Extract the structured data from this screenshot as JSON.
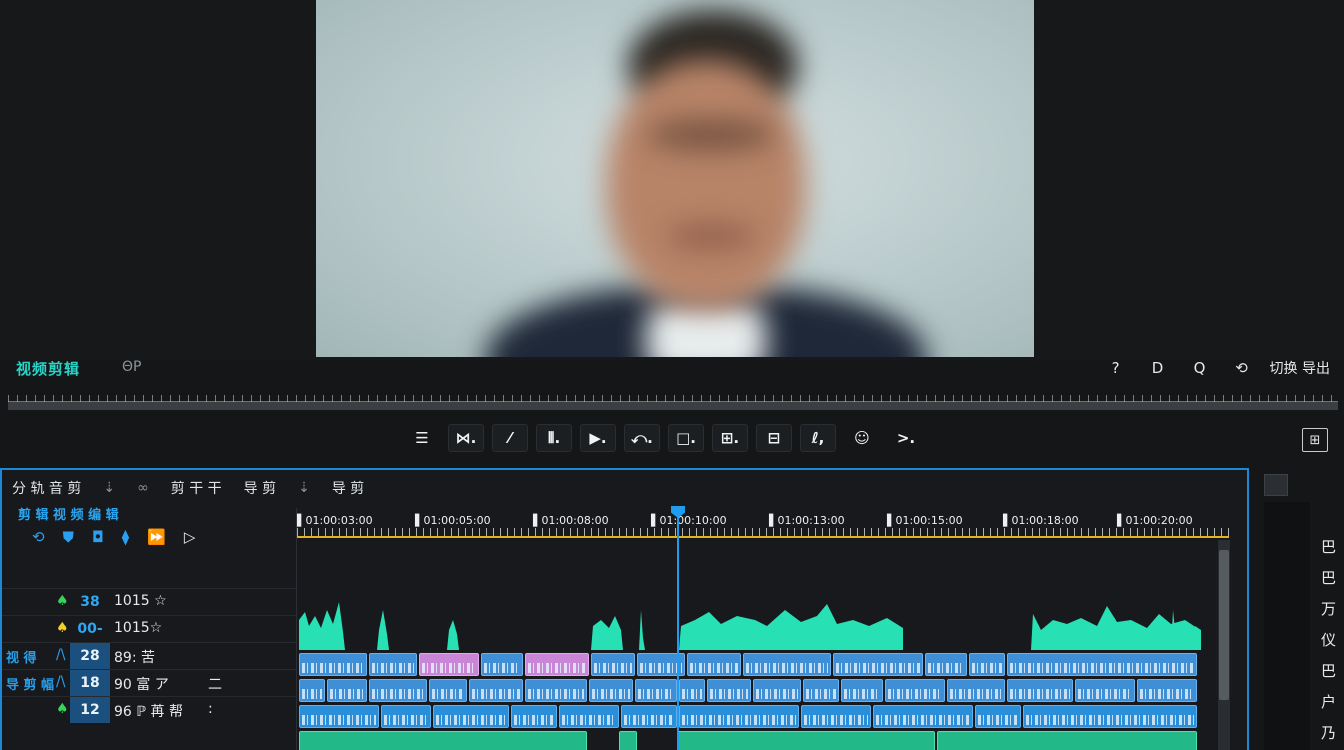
{
  "viewer": {
    "title": "视频剪辑",
    "subtitle": "ΘP",
    "tools": [
      "?",
      "D",
      "Q",
      "⟲"
    ],
    "tools_label": "切换 导出"
  },
  "transport": {
    "buttons": [
      "☰",
      "⋈.",
      "⁄",
      "⦀.",
      "▶.",
      "⤺.",
      "□.",
      "⊞.",
      "⊟",
      "ℓ,",
      "☺",
      ">."
    ],
    "fit_label": "⊞"
  },
  "timeline": {
    "toolbar": [
      "分 轨 音 剪",
      "⇣",
      "∞",
      "剪 干 干",
      "导 剪",
      "⇣",
      "导 剪"
    ],
    "title": "剪 辑 视 频 编 辑",
    "icons": [
      "⟲",
      "⛊",
      "◘",
      "⧫",
      "⏩",
      "▷"
    ],
    "ruler_labels": [
      "▌01:00:03:00",
      "▌01:00:05:00",
      "▌01:00:08:00",
      "▌01:00:10:00",
      "▌01:00:13:00",
      "▌01:00:15:00",
      "▌01:00:18:00",
      "▌01:00:20:00"
    ],
    "tracks": [
      {
        "lock": "♠",
        "num": "38",
        "name": "1015 ☆",
        "side": "",
        "extra": ""
      },
      {
        "lock": "♠",
        "num": "00-",
        "name": "1015☆",
        "side": "",
        "extra": ""
      },
      {
        "lock": "/\\",
        "num": "28",
        "name": "89: 苦",
        "side": "视 得",
        "extra": ""
      },
      {
        "lock": "/\\",
        "num": "18",
        "name": "90 富 ア",
        "side": "导 剪 幅",
        "extra": "二"
      },
      {
        "lock": "♠",
        "num": "12",
        "name": "96 ℙ 苒 帮",
        "side": "",
        "extra": ":"
      }
    ]
  },
  "colors": {
    "accent": "#1e88d8",
    "teal": "#29d3c6",
    "video_clip": "#3f8fd6",
    "pink_clip": "#c986d6",
    "green_clip": "#23b888",
    "ruler_line": "#e6b21a"
  },
  "right_panel": {
    "icons": [
      "巴",
      "巴",
      "万",
      "仪",
      "巴",
      "户",
      "乃"
    ]
  }
}
